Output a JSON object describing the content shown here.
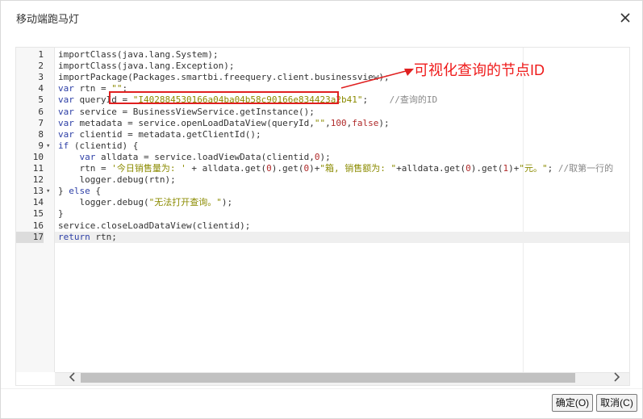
{
  "dialog": {
    "title": "移动端跑马灯",
    "ok_label": "确定(O)",
    "cancel_label": "取消(C)"
  },
  "editor": {
    "line_numbers": [
      "1",
      "2",
      "3",
      "4",
      "5",
      "6",
      "7",
      "8",
      "9",
      "10",
      "11",
      "12",
      "13",
      "14",
      "15",
      "16",
      "17"
    ],
    "active_line": "17",
    "fold_markers": {
      "9": "▾",
      "13": "▾"
    },
    "lines": [
      {
        "parts": [
          {
            "t": "importClass(java.lang.System);",
            "c": ""
          }
        ]
      },
      {
        "parts": [
          {
            "t": "importClass(java.lang.Exception);",
            "c": ""
          }
        ]
      },
      {
        "parts": [
          {
            "t": "importPackage(Packages.smartbi.freequery.client.businessview);",
            "c": ""
          }
        ]
      },
      {
        "parts": [
          {
            "t": "var",
            "c": "kw"
          },
          {
            "t": " rtn = ",
            "c": ""
          },
          {
            "t": "\"\"",
            "c": "str"
          },
          {
            "t": ";",
            "c": ""
          }
        ]
      },
      {
        "parts": [
          {
            "t": "var",
            "c": "kw"
          },
          {
            "t": " queryId = ",
            "c": ""
          },
          {
            "t": "\"I402884530166a04ba04b58c90166e834423a2b41\"",
            "c": "qid"
          },
          {
            "t": ";    ",
            "c": ""
          },
          {
            "t": "//查询的ID",
            "c": "cmt"
          }
        ]
      },
      {
        "parts": [
          {
            "t": "var",
            "c": "kw"
          },
          {
            "t": " service = BusinessViewService.getInstance();",
            "c": ""
          }
        ]
      },
      {
        "parts": [
          {
            "t": "var",
            "c": "kw"
          },
          {
            "t": " metadata = service.openLoadDataView(queryId,",
            "c": ""
          },
          {
            "t": "\"\"",
            "c": "str"
          },
          {
            "t": ",",
            "c": ""
          },
          {
            "t": "100",
            "c": "num"
          },
          {
            "t": ",",
            "c": ""
          },
          {
            "t": "false",
            "c": "num"
          },
          {
            "t": ");",
            "c": ""
          }
        ]
      },
      {
        "parts": [
          {
            "t": "var",
            "c": "kw"
          },
          {
            "t": " clientid = metadata.getClientId();",
            "c": ""
          }
        ]
      },
      {
        "parts": [
          {
            "t": "if",
            "c": "kw"
          },
          {
            "t": " (clientid) {",
            "c": ""
          }
        ]
      },
      {
        "parts": [
          {
            "t": "    ",
            "c": ""
          },
          {
            "t": "var",
            "c": "kw"
          },
          {
            "t": " alldata = service.loadViewData(clientid,",
            "c": ""
          },
          {
            "t": "0",
            "c": "num"
          },
          {
            "t": ");",
            "c": ""
          }
        ]
      },
      {
        "parts": [
          {
            "t": "    rtn = ",
            "c": ""
          },
          {
            "t": "'今日销售量为: '",
            "c": "str"
          },
          {
            "t": " + alldata.get(",
            "c": ""
          },
          {
            "t": "0",
            "c": "num"
          },
          {
            "t": ").get(",
            "c": ""
          },
          {
            "t": "0",
            "c": "num"
          },
          {
            "t": ")+",
            "c": ""
          },
          {
            "t": "\"箱, 销售额为: \"",
            "c": "str"
          },
          {
            "t": "+alldata.get(",
            "c": ""
          },
          {
            "t": "0",
            "c": "num"
          },
          {
            "t": ").get(",
            "c": ""
          },
          {
            "t": "1",
            "c": "num"
          },
          {
            "t": ")+",
            "c": ""
          },
          {
            "t": "\"元。\"",
            "c": "str"
          },
          {
            "t": "; ",
            "c": ""
          },
          {
            "t": "//取第一行的",
            "c": "cmt"
          }
        ]
      },
      {
        "parts": [
          {
            "t": "    logger.debug(rtn);",
            "c": ""
          }
        ]
      },
      {
        "parts": [
          {
            "t": "} ",
            "c": ""
          },
          {
            "t": "else",
            "c": "kw"
          },
          {
            "t": " {",
            "c": ""
          }
        ]
      },
      {
        "parts": [
          {
            "t": "    logger.debug(",
            "c": ""
          },
          {
            "t": "\"无法打开查询。\"",
            "c": "str"
          },
          {
            "t": ");",
            "c": ""
          }
        ]
      },
      {
        "parts": [
          {
            "t": "}",
            "c": ""
          }
        ]
      },
      {
        "parts": [
          {
            "t": "service.closeLoadDataView(clientid);",
            "c": ""
          }
        ]
      },
      {
        "parts": [
          {
            "t": "return",
            "c": "kw"
          },
          {
            "t": " rtn;",
            "c": ""
          }
        ]
      }
    ]
  },
  "annotation": {
    "text": "可视化查询的节点ID",
    "color": "#ef1b1b"
  },
  "icons": {
    "close": "close-icon",
    "scroll_left": "chevron-left-icon",
    "scroll_right": "chevron-right-icon"
  }
}
